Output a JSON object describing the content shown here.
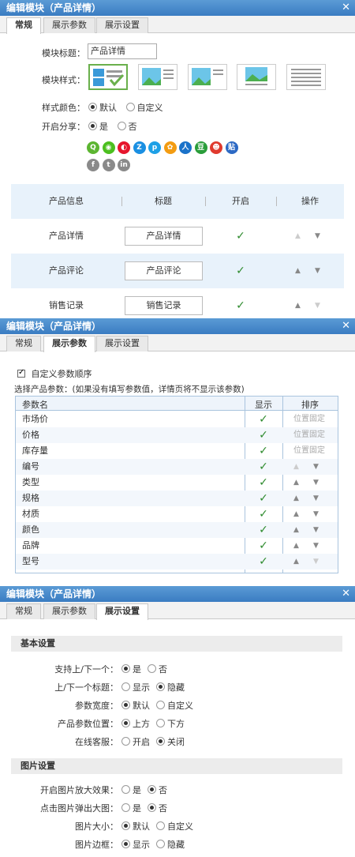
{
  "p1": {
    "title": "编辑模块（产品详情）",
    "close": "✕",
    "tabs": [
      "常规",
      "展示参数",
      "展示设置"
    ],
    "module_title_label": "模块标题：",
    "module_title_value": "产品详情",
    "module_style_label": "模块样式：",
    "style_color_label": "样式颜色：",
    "style_color_options": [
      "默认",
      "自定义"
    ],
    "share_label": "开启分享：",
    "share_options": [
      "是",
      "否"
    ],
    "share_icons_row1": [
      {
        "name": "share-icon-1",
        "glyph": "Q",
        "color": "#5cb531"
      },
      {
        "name": "share-icon-2",
        "glyph": "◉",
        "color": "#4cbf1f"
      },
      {
        "name": "share-icon-3",
        "glyph": "◐",
        "color": "#e6162d"
      },
      {
        "name": "share-icon-4",
        "glyph": "Z",
        "color": "#1a8fe2"
      },
      {
        "name": "share-icon-5",
        "glyph": "p",
        "color": "#1ea0e6"
      },
      {
        "name": "share-icon-6",
        "glyph": "✿",
        "color": "#f39c12"
      },
      {
        "name": "share-icon-7",
        "glyph": "人",
        "color": "#1a72c9"
      },
      {
        "name": "share-icon-8",
        "glyph": "豆",
        "color": "#2a9d3a"
      },
      {
        "name": "share-icon-9",
        "glyph": "☻",
        "color": "#e03a2e"
      },
      {
        "name": "share-icon-10",
        "glyph": "贴",
        "color": "#2c69c4"
      }
    ],
    "share_icons_row2": [
      {
        "name": "facebook-icon",
        "glyph": "f",
        "color": "#8a8a8a"
      },
      {
        "name": "twitter-icon",
        "glyph": "t",
        "color": "#8a8a8a"
      },
      {
        "name": "linkedin-icon",
        "glyph": "in",
        "color": "#8a8a8a"
      }
    ],
    "table": {
      "headers": [
        "产品信息",
        "标题",
        "开启",
        "操作"
      ],
      "rows": [
        {
          "name": "产品详情",
          "title": "产品详情",
          "enabled": "✓"
        },
        {
          "name": "产品评论",
          "title": "产品评论",
          "enabled": "✓"
        },
        {
          "name": "销售记录",
          "title": "销售记录",
          "enabled": "✓"
        }
      ]
    }
  },
  "p2": {
    "title": "编辑模块（产品详情）",
    "close": "✕",
    "tabs": [
      "常规",
      "展示参数",
      "展示设置"
    ],
    "custom_order_label": "自定义参数顺序",
    "choose_label": "选择产品参数：(如果没有填写参数值，详情页将不显示该参数)",
    "headers": [
      "参数名",
      "显示",
      "排序"
    ],
    "rows": [
      {
        "name": "市场价",
        "shown": "✓",
        "sort": "位置固定"
      },
      {
        "name": "价格",
        "shown": "✓",
        "sort": "位置固定"
      },
      {
        "name": "库存量",
        "shown": "✓",
        "sort": "位置固定"
      },
      {
        "name": "编号",
        "shown": "✓",
        "sort": ""
      },
      {
        "name": "类型",
        "shown": "✓",
        "sort": ""
      },
      {
        "name": "规格",
        "shown": "✓",
        "sort": ""
      },
      {
        "name": "材质",
        "shown": "✓",
        "sort": ""
      },
      {
        "name": "颜色",
        "shown": "✓",
        "sort": ""
      },
      {
        "name": "品牌",
        "shown": "✓",
        "sort": ""
      },
      {
        "name": "型号",
        "shown": "✓",
        "sort": ""
      }
    ]
  },
  "p3": {
    "title": "编辑模块（产品详情）",
    "close": "✕",
    "tabs": [
      "常规",
      "展示参数",
      "展示设置"
    ],
    "basic_section": "基本设置",
    "basic": [
      {
        "label": "支持上/下一个：",
        "options": [
          "是",
          "否"
        ],
        "selected": 0
      },
      {
        "label": "上/下一个标题：",
        "options": [
          "显示",
          "隐藏"
        ],
        "selected": 1
      },
      {
        "label": "参数宽度：",
        "options": [
          "默认",
          "自定义"
        ],
        "selected": 0
      },
      {
        "label": "产品参数位置：",
        "options": [
          "上方",
          "下方"
        ],
        "selected": 0
      },
      {
        "label": "在线客服：",
        "options": [
          "开启",
          "关闭"
        ],
        "selected": 1
      }
    ],
    "image_section": "图片设置",
    "image": [
      {
        "label": "开启图片放大效果：",
        "options": [
          "是",
          "否"
        ],
        "selected": 1
      },
      {
        "label": "点击图片弹出大图：",
        "options": [
          "是",
          "否"
        ],
        "selected": 1
      },
      {
        "label": "图片大小：",
        "options": [
          "默认",
          "自定义"
        ],
        "selected": 0
      },
      {
        "label": "图片边框：",
        "options": [
          "显示",
          "隐藏"
        ],
        "selected": 0
      }
    ]
  }
}
